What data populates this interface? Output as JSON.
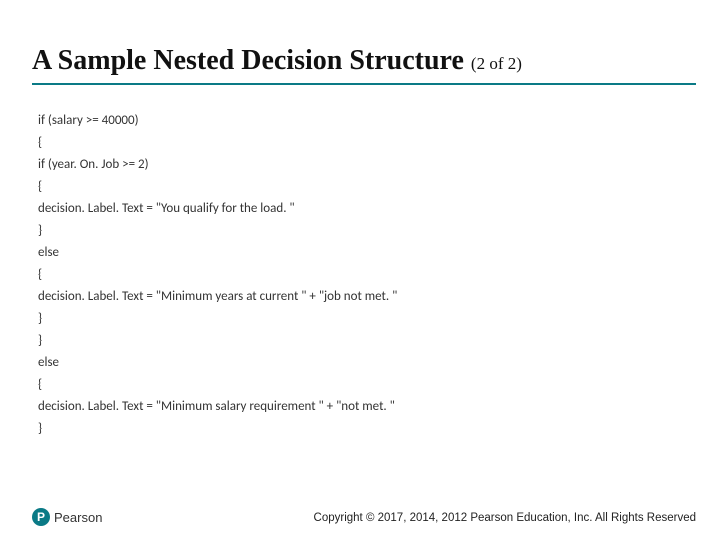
{
  "title": {
    "main": "A Sample Nested Decision Structure ",
    "sub": "(2 of 2)"
  },
  "code": "if (salary >= 40000)\n{\nif (year. On. Job >= 2)\n{\ndecision. Label. Text = \"You qualify for the load. \"\n}\nelse\n{\ndecision. Label. Text = \"Minimum years at current \" + \"job not met. \"\n}\n}\nelse\n{\ndecision. Label. Text = \"Minimum salary requirement \" + \"not met. \"\n}",
  "logo": {
    "letter": "P",
    "brand": "Pearson"
  },
  "copyright": "Copyright © 2017, 2014, 2012 Pearson Education, Inc. All Rights Reserved"
}
